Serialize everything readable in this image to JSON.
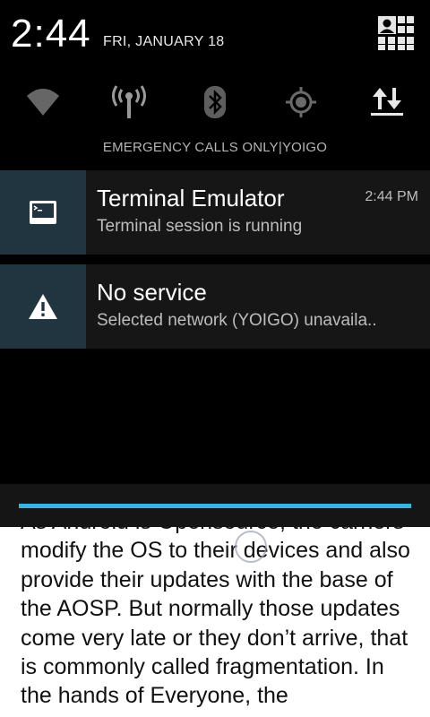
{
  "header": {
    "time": "2:44",
    "date": "FRI, JANUARY 18"
  },
  "quick_settings": [
    {
      "icon": "wifi-icon"
    },
    {
      "icon": "signal-tower-icon"
    },
    {
      "icon": "bluetooth-icon"
    },
    {
      "icon": "gps-icon"
    },
    {
      "icon": "data-transfer-icon"
    }
  ],
  "carrier_text": "EMERGENCY CALLS ONLY|YOIGO",
  "notifications": [
    {
      "title": "Terminal Emulator",
      "text": "Terminal session is running",
      "time": "2:44 PM",
      "icon": "terminal-icon"
    },
    {
      "title": "No service",
      "text": "Selected network (YOIGO) unavaila..",
      "time": "",
      "icon": "warning-icon"
    }
  ],
  "article": {
    "text": "As Android is Opensource, the carriers modify the OS to their devices and also provide their updates with the base of the AOSP. But normally those updates come very late or they don’t arrive, that is commonly called fragmentation. In the hands of Everyone, the"
  },
  "colors": {
    "accent": "#33b5e5",
    "icon_box": "#213540",
    "notif_bg": "#161616"
  }
}
